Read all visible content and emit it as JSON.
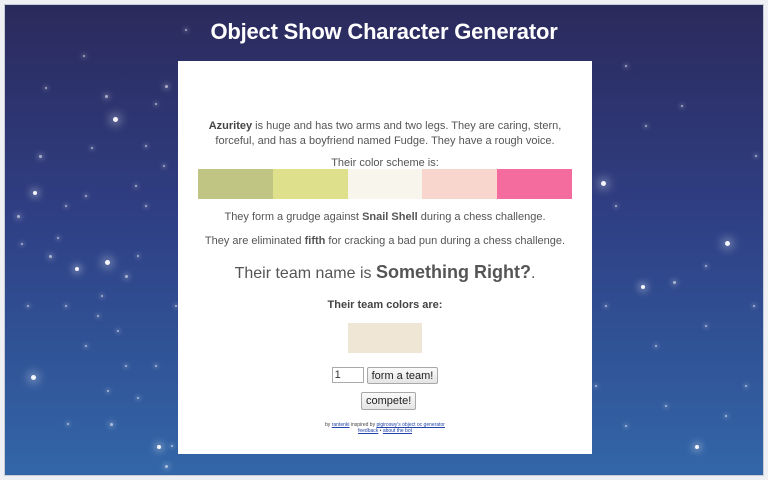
{
  "header": {
    "title": "Object Show Character Generator"
  },
  "character": {
    "name": "Azuritey",
    "description": "is huge and has two arms and two legs. They are caring, stern, forceful, and has a boyfriend named Fudge. They have a rough voice."
  },
  "color_scheme": {
    "label": "Their color scheme is:",
    "colors": [
      "#c1c583",
      "#dee08b",
      "#f8f6ec",
      "#f8d5cd",
      "#f46b9d"
    ]
  },
  "grudge": {
    "prefix": "They form a grudge against",
    "target": "Snail Shell",
    "suffix": "during a chess challenge."
  },
  "elimination": {
    "prefix": "They are eliminated",
    "place": "fifth",
    "suffix": "for cracking a bad pun during a chess challenge."
  },
  "team": {
    "prefix": "Their team name is",
    "name": "Something Right?",
    "suffix": ".",
    "colors_label": "Their team colors are:",
    "colors": [
      "#f0e6d6"
    ]
  },
  "controls": {
    "team_size_value": "1",
    "form_team_label": "form a team!",
    "compete_label": "compete!"
  },
  "footer": {
    "by": "by",
    "author": "rantenki",
    "inspired": "inspired by",
    "inspired_link": "pigiroswy's object oc generator",
    "feedback": "feedback",
    "separator": "•",
    "about": "about the bot"
  }
}
